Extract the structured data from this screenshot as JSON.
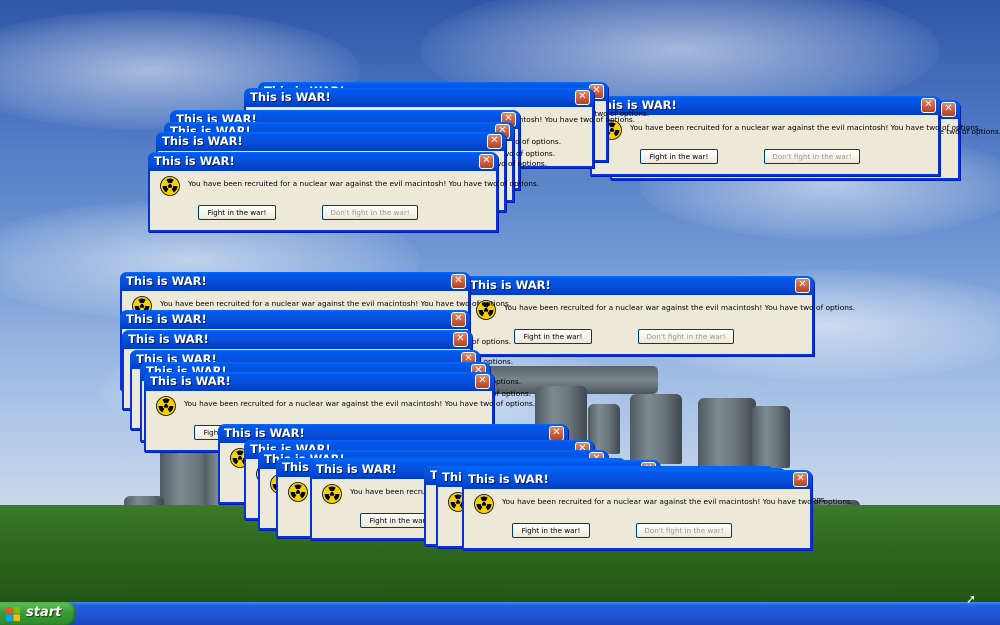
{
  "dialog": {
    "title": "This is WAR!",
    "message": "You have been recruited for a nuclear war against the evil macintosh! You have two of options.",
    "fight_button": "Fight in the war!",
    "dont_fight_button": "Don't fight in the war!",
    "close_symbol": "✕",
    "icon": "radiation-icon"
  },
  "taskbar": {
    "start_label": "start",
    "start_icon": "windows-logo-icon"
  },
  "colors": {
    "titlebar": "#0a4fd8",
    "dialog_body": "#ece9d8",
    "close_button": "#b94020",
    "start_button": "#3a9c35",
    "taskbar": "#245edb"
  }
}
